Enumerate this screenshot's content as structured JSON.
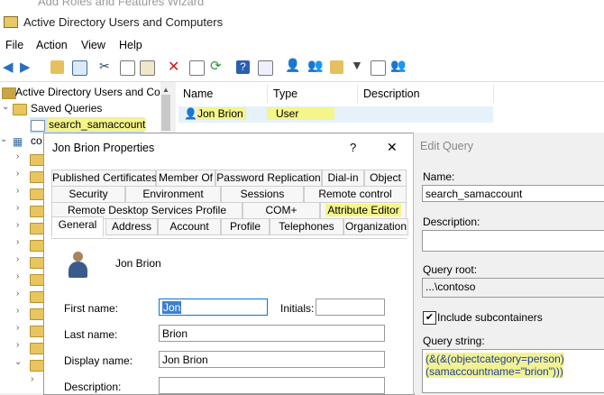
{
  "background_window": {
    "title": "Add Roles and Features Wizard"
  },
  "window": {
    "title": "Active Directory Users and Computers"
  },
  "menu": [
    "File",
    "Action",
    "View",
    "Help"
  ],
  "tree": {
    "root": "Active Directory Users and Co",
    "saved_queries": "Saved Queries",
    "query": "search_samaccount",
    "domain": "co"
  },
  "list": {
    "columns": [
      "Name",
      "Type",
      "Description"
    ],
    "rows": [
      {
        "name": "Jon Brion",
        "type": "User",
        "description": ""
      }
    ]
  },
  "properties": {
    "title": "Jon Brion Properties",
    "help": "?",
    "close": "✕",
    "tabs_row1": [
      "Published Certificates",
      "Member Of",
      "Password Replication",
      "Dial-in",
      "Object"
    ],
    "tabs_row2": [
      "Security",
      "Environment",
      "Sessions",
      "Remote control"
    ],
    "tabs_row3": [
      "Remote Desktop Services Profile",
      "COM+",
      "Attribute Editor"
    ],
    "tabs_row4": [
      "General",
      "Address",
      "Account",
      "Profile",
      "Telephones",
      "Organization"
    ],
    "display_header": "Jon Brion",
    "labels": {
      "first_name": "First name:",
      "initials": "Initials:",
      "last_name": "Last name:",
      "display_name": "Display name:",
      "description": "Description:"
    },
    "values": {
      "first_name": "Jon",
      "initials": "",
      "last_name": "Brion",
      "display_name": "Jon Brion",
      "description": ""
    }
  },
  "edit_query": {
    "title": "Edit Query",
    "name_label": "Name:",
    "name_value": "search_samaccount",
    "description_label": "Description:",
    "description_value": "",
    "query_root_label": "Query root:",
    "query_root_value": "...\\contoso",
    "include_subcontainers_label": "Include subcontainers",
    "include_subcontainers_checked": true,
    "query_string_label": "Query string:",
    "query_string_line1": "(&(&(objectcategory=person)",
    "query_string_line2": "(samaccountname=\"brion\")))"
  },
  "colors": {
    "highlight": "#f5f58a",
    "selection": "#cce8ff",
    "accent": "#1e5fa8"
  }
}
